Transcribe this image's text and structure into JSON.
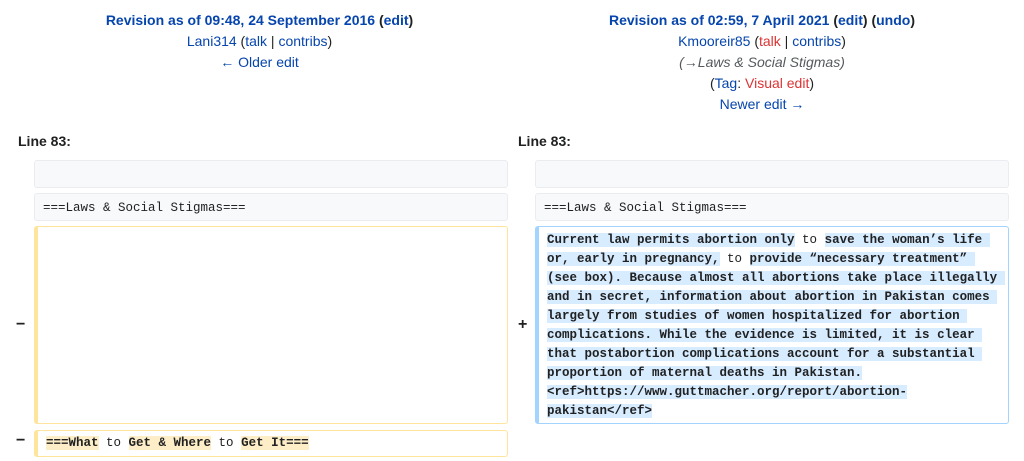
{
  "left_header": {
    "revision": "Revision as of 09:48, 24 September 2016",
    "edit": "edit",
    "user": "Lani314",
    "talk": "talk",
    "contribs": "contribs",
    "older": "← Older edit"
  },
  "right_header": {
    "revision": "Revision as of 02:59, 7 April 2021",
    "edit": "edit",
    "undo": "undo",
    "user": "Kmooreir85",
    "talk": "talk",
    "contribs": "contribs",
    "summary": "(→Laws & Social Stigmas)",
    "tag_prefix": "Tag",
    "tag": "Visual edit",
    "newer": "Newer edit →"
  },
  "left_line_label": "Line 83:",
  "right_line_label": "Line 83:",
  "context_line": "===Laws & Social Stigmas===",
  "markers": {
    "minus": "−",
    "plus": "+"
  },
  "added_segments": [
    {
      "text": "Current law permits abortion only",
      "hl": true
    },
    {
      "text": " to ",
      "hl": false
    },
    {
      "text": "save the woman’s life or, early in pregnancy,",
      "hl": true
    },
    {
      "text": " to ",
      "hl": false
    },
    {
      "text": "provide “necessary treatment” (see box). Because almost all abortions take place illegally and in secret, information about abortion in Pakistan comes largely from studies of women hospitalized for abortion complications. While the evidence is limited, it is clear that postabortion complications account for a substantial proportion of maternal deaths in Pakistan.<ref>https://www.guttmacher.org/report/abortion-pakistan</ref>",
      "hl": true
    }
  ],
  "deleted_segments": [
    {
      "text": "===What",
      "hl": true
    },
    {
      "text": " to ",
      "hl": false
    },
    {
      "text": "Get & Where",
      "hl": true
    },
    {
      "text": " to ",
      "hl": false
    },
    {
      "text": "Get It===",
      "hl": true
    }
  ]
}
